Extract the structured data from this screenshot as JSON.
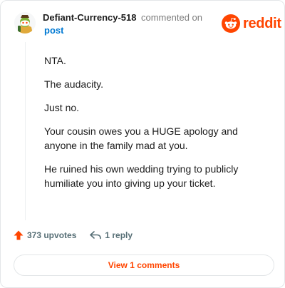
{
  "comment": {
    "author": "Defiant-Currency-518",
    "action_text": "commented on",
    "post_link": "post",
    "paragraphs": [
      "NTA.",
      "The audacity.",
      "Just no.",
      "Your cousin owes you a HUGE apology and anyone in the family mad at you.",
      "He ruined his own wedding trying to publicly humiliate you into giving up your ticket."
    ]
  },
  "brand": {
    "wordmark": "reddit",
    "color": "#ff4500"
  },
  "actions": {
    "upvotes": "373 upvotes",
    "upvote_icon": "arrow-up-icon",
    "reply": "1 reply",
    "reply_icon": "reply-icon"
  },
  "footer": {
    "view_comments": "View 1 comments"
  },
  "colors": {
    "accent": "#ff4500",
    "link": "#0079d3",
    "text": "#1c1c1c",
    "muted": "#7c7c7c",
    "action": "#576f76",
    "border": "#e3e6e8"
  }
}
